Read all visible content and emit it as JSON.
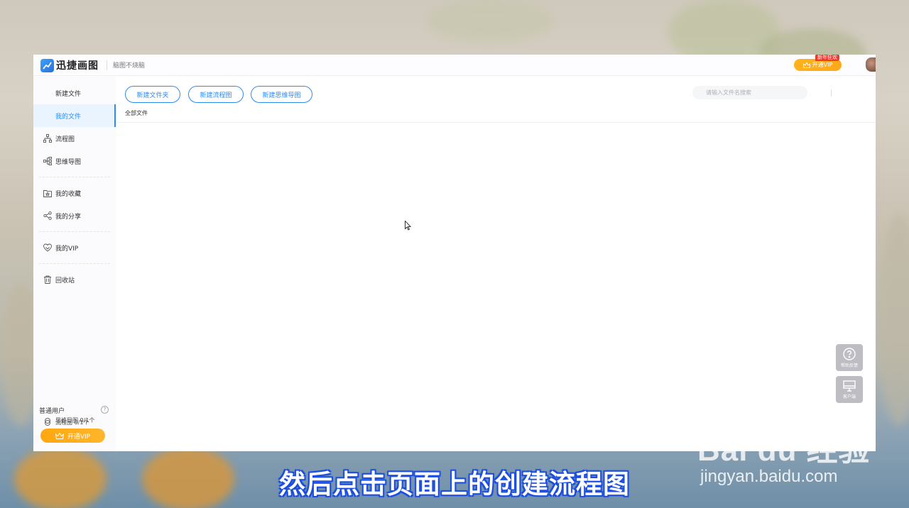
{
  "app": {
    "name": "迅捷画图",
    "slogan": "脑图不烧脑",
    "vip_button": "开通VIP",
    "vip_badge": "新年狂欢",
    "accent_color": "#2d8cf0",
    "vip_color": "#ffad1a"
  },
  "sidebar": {
    "items": [
      {
        "label": "新建文件",
        "icon": "none"
      },
      {
        "label": "我的文件",
        "icon": "none",
        "active": true
      },
      {
        "label": "流程图",
        "icon": "flowchart-icon"
      },
      {
        "label": "思维导图",
        "icon": "mindmap-icon"
      },
      {
        "label": "我的收藏",
        "icon": "favorites-folder-icon"
      },
      {
        "label": "我的分享",
        "icon": "share-icon"
      },
      {
        "label": "我的VIP",
        "icon": "diamond-icon"
      },
      {
        "label": "回收站",
        "icon": "trash-icon"
      }
    ],
    "user_type": "普通用户",
    "help_icon": "?",
    "quota": [
      "流程图 0/1个",
      "思维导图 0/1个"
    ],
    "vip_button": "开通VIP"
  },
  "toolbar": {
    "new_folder": "新建文件夹",
    "new_flowchart": "新建流程图",
    "new_mindmap": "新建思维导图",
    "search_placeholder": "请输入文件名搜索"
  },
  "breadcrumb": "全部文件",
  "float_buttons": {
    "help": "帮助反馈",
    "client": "客户端"
  },
  "caption": "然后点击页面上的创建流程图",
  "watermark": {
    "logo": "Bai du 经验",
    "url": "jingyan.baidu.com"
  }
}
